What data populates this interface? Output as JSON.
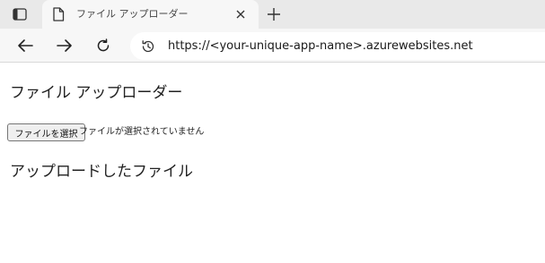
{
  "browser": {
    "tab": {
      "title": "ファイル アップローダー"
    },
    "address_bar": {
      "url": "https://<your-unique-app-name>.azurewebsites.net"
    }
  },
  "page": {
    "heading": "ファイル アップローダー",
    "file_input": {
      "button_label": "ファイルを選択",
      "status_text": "ファイルが選択されていません"
    },
    "uploaded_heading": "アップロードしたファイル"
  }
}
